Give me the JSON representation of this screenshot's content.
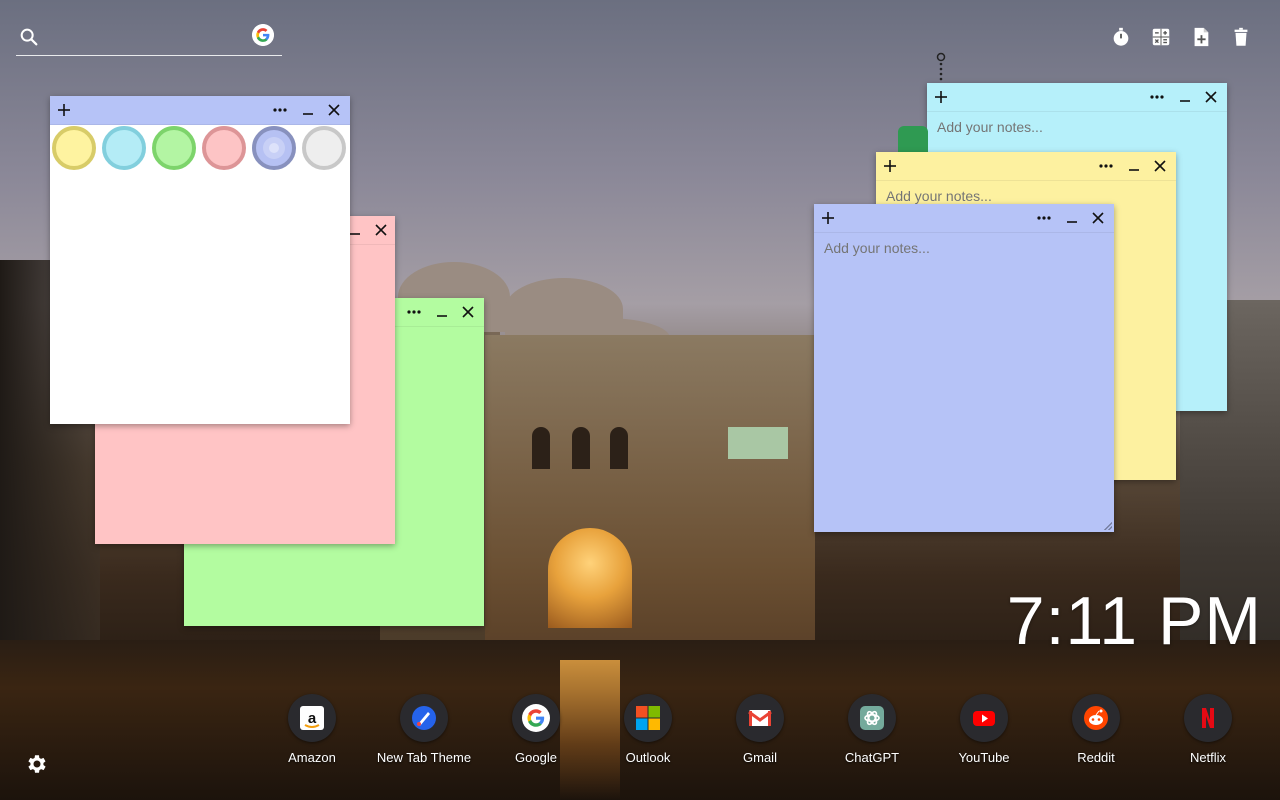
{
  "search": {
    "placeholder": ""
  },
  "toolbar": {
    "items": [
      {
        "icon": "stopwatch-icon"
      },
      {
        "icon": "calculator-icon"
      },
      {
        "icon": "new-note-icon"
      },
      {
        "icon": "trash-icon"
      }
    ]
  },
  "notes": {
    "color_picker": {
      "swatches": [
        {
          "color": "#fef3a0",
          "border": "#d8cc68"
        },
        {
          "color": "#b4ecf6",
          "border": "#82cfdd"
        },
        {
          "color": "#b3f5a3",
          "border": "#7dd46b"
        },
        {
          "color": "#fdc4c5",
          "border": "#dd9597"
        },
        {
          "color": "#b6c1f3",
          "border": "#8891be",
          "selected": true
        },
        {
          "color": "#eeeeee",
          "border": "#c8c8c8"
        }
      ]
    },
    "pink_note_color": "#ffc4c5",
    "green_note_color": "#b3fca0",
    "cyan_note": {
      "color": "#b6f0fa",
      "placeholder": "Add your notes..."
    },
    "yellow_note": {
      "color": "#fdf1a0",
      "placeholder": "Add your notes..."
    },
    "blue_note": {
      "color": "#b6c3f7",
      "placeholder": "Add your notes..."
    }
  },
  "clock": {
    "time": "7:11 PM"
  },
  "shortcuts": [
    {
      "label": "Amazon",
      "icon": "amazon-icon"
    },
    {
      "label": "New Tab Theme",
      "icon": "new-tab-theme-icon"
    },
    {
      "label": "Google",
      "icon": "google-icon"
    },
    {
      "label": "Outlook",
      "icon": "outlook-icon"
    },
    {
      "label": "Gmail",
      "icon": "gmail-icon"
    },
    {
      "label": "ChatGPT",
      "icon": "chatgpt-icon"
    },
    {
      "label": "YouTube",
      "icon": "youtube-icon"
    },
    {
      "label": "Reddit",
      "icon": "reddit-icon"
    },
    {
      "label": "Netflix",
      "icon": "netflix-icon"
    }
  ]
}
